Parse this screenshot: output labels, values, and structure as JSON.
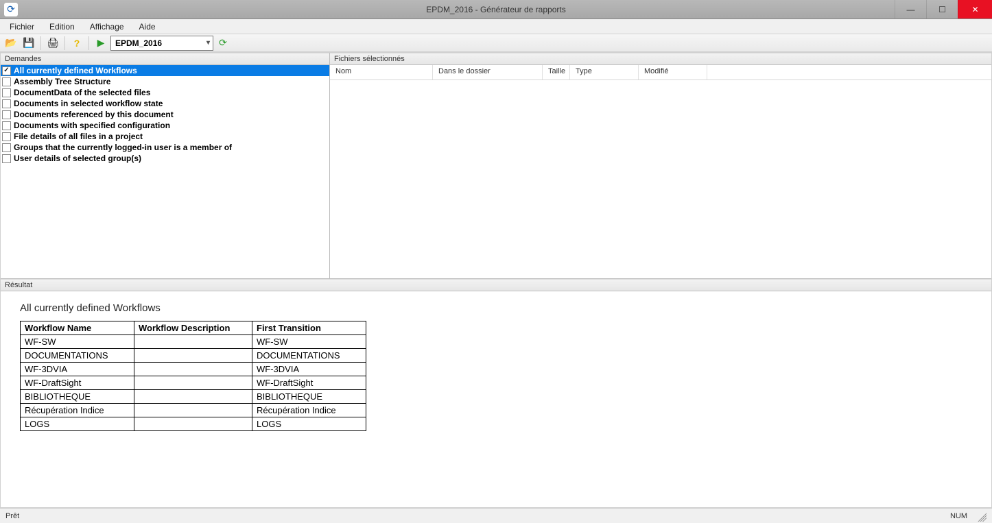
{
  "window": {
    "title": "EPDM_2016 - Générateur de rapports"
  },
  "menu": {
    "file": "Fichier",
    "edit": "Edition",
    "view": "Affichage",
    "help": "Aide"
  },
  "toolbar": {
    "vault_selected": "EPDM_2016"
  },
  "panels": {
    "demands_title": "Demandes",
    "files_title": "Fichiers sélectionnés",
    "result_title": "Résultat"
  },
  "demands": [
    {
      "label": "All currently defined Workflows",
      "checked": true,
      "selected": true
    },
    {
      "label": "Assembly Tree Structure",
      "checked": false,
      "selected": false
    },
    {
      "label": "DocumentData of the selected files",
      "checked": false,
      "selected": false
    },
    {
      "label": "Documents in selected workflow state",
      "checked": false,
      "selected": false
    },
    {
      "label": "Documents referenced by this document",
      "checked": false,
      "selected": false
    },
    {
      "label": "Documents with specified configuration",
      "checked": false,
      "selected": false
    },
    {
      "label": "File details of all files in a project",
      "checked": false,
      "selected": false
    },
    {
      "label": "Groups that the currently logged-in user is a member of",
      "checked": false,
      "selected": false
    },
    {
      "label": "User details of selected group(s)",
      "checked": false,
      "selected": false
    }
  ],
  "file_columns": {
    "name": "Nom",
    "folder": "Dans le dossier",
    "size": "Taille",
    "type": "Type",
    "modified": "Modifié"
  },
  "result": {
    "heading": "All currently defined Workflows",
    "columns": {
      "name": "Workflow Name",
      "desc": "Workflow Description",
      "trans": "First Transition"
    },
    "rows": [
      {
        "name": "WF-SW",
        "desc": "",
        "trans": "WF-SW"
      },
      {
        "name": "DOCUMENTATIONS",
        "desc": "",
        "trans": "DOCUMENTATIONS"
      },
      {
        "name": "WF-3DVIA",
        "desc": "",
        "trans": "WF-3DVIA"
      },
      {
        "name": "WF-DraftSight",
        "desc": "",
        "trans": "WF-DraftSight"
      },
      {
        "name": "BIBLIOTHEQUE",
        "desc": "",
        "trans": "BIBLIOTHEQUE"
      },
      {
        "name": "Récupération Indice",
        "desc": "",
        "trans": "Récupération Indice"
      },
      {
        "name": "LOGS",
        "desc": "",
        "trans": "LOGS"
      }
    ]
  },
  "status": {
    "ready": "Prêt",
    "num": "NUM"
  }
}
